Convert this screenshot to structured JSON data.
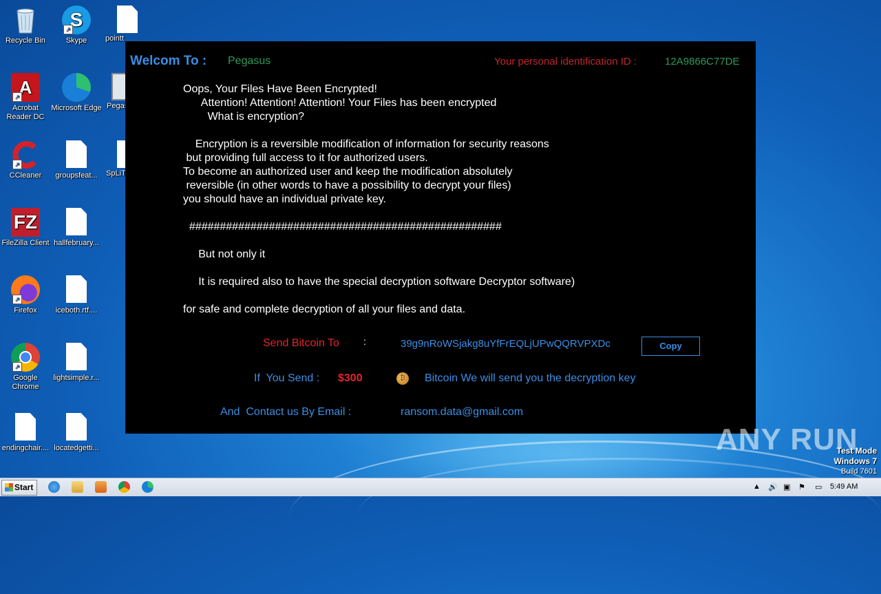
{
  "desktop": {
    "icons": [
      {
        "label": "Recycle Bin",
        "icon": "recycle-bin-icon"
      },
      {
        "label": "Skype",
        "icon": "skype-icon"
      },
      {
        "label": "pointt",
        "icon": "document-icon"
      },
      {
        "label": "Acrobat Reader DC",
        "icon": "acrobat-icon"
      },
      {
        "label": "Microsoft Edge",
        "icon": "edge-icon"
      },
      {
        "label": "Pegas",
        "icon": "image-icon"
      },
      {
        "label": "CCleaner",
        "icon": "ccleaner-icon"
      },
      {
        "label": "groupsfeat...",
        "icon": "document-icon"
      },
      {
        "label": "SpLiT",
        "icon": "document-icon"
      },
      {
        "label": "FileZilla Client",
        "icon": "filezilla-icon"
      },
      {
        "label": "hallfebruary...",
        "icon": "document-icon"
      },
      {
        "label": "Firefox",
        "icon": "firefox-icon"
      },
      {
        "label": "iceboth.rtf....",
        "icon": "document-icon"
      },
      {
        "label": "Google Chrome",
        "icon": "chrome-icon"
      },
      {
        "label": "lightsimple.r...",
        "icon": "document-icon"
      },
      {
        "label": "endingchair....",
        "icon": "document-icon"
      },
      {
        "label": "locatedgetti...",
        "icon": "document-icon"
      }
    ]
  },
  "ransom": {
    "welcome_label": "Welcom To :",
    "ransomware_name": "Pegasus",
    "id_label": "Your personal identification ID :",
    "id_value": "12A9866C77DE",
    "lines": [
      "Oops, Your Files Have Been Encrypted!",
      "      Attention! Attention! Attention! Your Files has been encrypted",
      "        What is encryption?",
      "    Encryption is a reversible modification of information for security reasons",
      " but providing full access to it for authorized users.",
      "To become an authorized user and keep the modification absolutely",
      " reversible (in other words to have a possibility to decrypt your files)",
      "you should have an individual private key.",
      "  ###################################################",
      "     But not only it",
      "     It is required also to have the special decryption software Decryptor software)",
      "for safe and complete decryption of all your files and data."
    ],
    "send_bitcoin_label": "Send Bitcoin To",
    "send_colon": ":",
    "bitcoin_address": "39g9nRoWSjakg8uYfFrEQLjUPwQQRVPXDc",
    "copy_label": "Copy",
    "if_you_send_label": "If  You Send :",
    "amount": "$300",
    "bitcoin_promise": "Bitcoin We will send you the decryption key",
    "contact_label": "And  Contact us By Email :",
    "email": "ransom.data@gmail.com"
  },
  "watermark": {
    "brand": "ANY RUN",
    "test_mode": "Test Mode",
    "os": "Windows 7",
    "build": "Build 7601"
  },
  "taskbar": {
    "start_label": "Start",
    "clock": "5:49 AM",
    "pinned": [
      "internet-explorer-icon",
      "explorer-icon",
      "media-player-icon",
      "chrome-icon",
      "edge-icon"
    ]
  },
  "colors": {
    "accent_blue": "#3a8ee6",
    "alert_red": "#e0262c",
    "name_green": "#2f9a5a",
    "window_bg": "#000000"
  }
}
